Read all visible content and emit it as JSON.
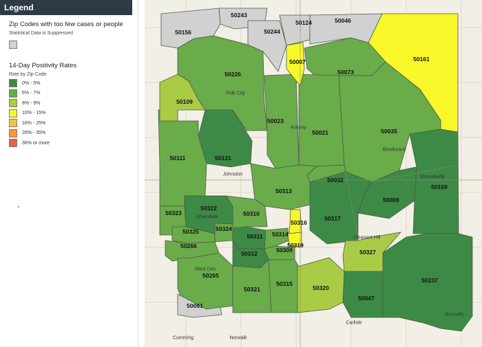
{
  "legend": {
    "header": "Legend",
    "suppressed_title": "Zip Codes with too few cases or people",
    "suppressed_label": "Statistical Data is Suppressed",
    "suppressed_color": "#d1d1d1",
    "rates_title": "14-Day Positivity Rates",
    "rates_sub": "Rate by Zip Code",
    "items": [
      {
        "label": "0% - 5%",
        "color": "#3d8a46"
      },
      {
        "label": "6% - 7%",
        "color": "#6aab4a"
      },
      {
        "label": "8% - 9%",
        "color": "#aacb45"
      },
      {
        "label": "10% - 15%",
        "color": "#f7f72a"
      },
      {
        "label": "16% - 25%",
        "color": "#f8c24a"
      },
      {
        "label": "26% - 35%",
        "color": "#f59a3c"
      },
      {
        "label": "36% or more",
        "color": "#ee5d4b"
      }
    ]
  },
  "map": {
    "zips": [
      {
        "code": "50243",
        "rate_class": "suppressed"
      },
      {
        "code": "50156",
        "rate_class": "suppressed"
      },
      {
        "code": "50244",
        "rate_class": "suppressed"
      },
      {
        "code": "50124",
        "rate_class": "suppressed"
      },
      {
        "code": "50046",
        "rate_class": "suppressed"
      },
      {
        "code": "50161",
        "rate_class": "10% - 15%"
      },
      {
        "code": "50007",
        "rate_class": "10% - 15%"
      },
      {
        "code": "50226",
        "rate_class": "6% - 7%"
      },
      {
        "code": "50073",
        "rate_class": "6% - 7%"
      },
      {
        "code": "50109",
        "rate_class": "8% - 9%"
      },
      {
        "code": "50023",
        "rate_class": "6% - 7%"
      },
      {
        "code": "50021",
        "rate_class": "6% - 7%"
      },
      {
        "code": "50035",
        "rate_class": "6% - 7%"
      },
      {
        "code": "50111",
        "rate_class": "6% - 7%"
      },
      {
        "code": "50131",
        "rate_class": "0% - 5%"
      },
      {
        "code": "50032",
        "rate_class": "6% - 7%"
      },
      {
        "code": "50169",
        "rate_class": "0% - 5%"
      },
      {
        "code": "50313",
        "rate_class": "6% - 7%"
      },
      {
        "code": "50009",
        "rate_class": "0% - 5%"
      },
      {
        "code": "50322",
        "rate_class": "0% - 5%"
      },
      {
        "code": "50310",
        "rate_class": "6% - 7%"
      },
      {
        "code": "50323",
        "rate_class": "6% - 7%"
      },
      {
        "code": "50316",
        "rate_class": "10% - 15%"
      },
      {
        "code": "50317",
        "rate_class": "0% - 5%"
      },
      {
        "code": "50325",
        "rate_class": "6% - 7%"
      },
      {
        "code": "50324",
        "rate_class": "6% - 7%"
      },
      {
        "code": "50314",
        "rate_class": "6% - 7%"
      },
      {
        "code": "50311",
        "rate_class": "0% - 5%"
      },
      {
        "code": "50319",
        "rate_class": "10% - 15%"
      },
      {
        "code": "50266",
        "rate_class": "6% - 7%"
      },
      {
        "code": "50309",
        "rate_class": "6% - 7%"
      },
      {
        "code": "50312",
        "rate_class": "0% - 5%"
      },
      {
        "code": "50327",
        "rate_class": "8% - 9%"
      },
      {
        "code": "50265",
        "rate_class": "6% - 7%"
      },
      {
        "code": "50237",
        "rate_class": "0% - 5%"
      },
      {
        "code": "50315",
        "rate_class": "6% - 7%"
      },
      {
        "code": "50320",
        "rate_class": "8% - 9%"
      },
      {
        "code": "50321",
        "rate_class": "6% - 7%"
      },
      {
        "code": "50047",
        "rate_class": "0% - 5%"
      },
      {
        "code": "50061",
        "rate_class": "suppressed"
      }
    ],
    "places": [
      "Polk City",
      "Ankeny",
      "Bondurant",
      "Johnston",
      "Urbandale",
      "Pleasant Hill",
      "West Des",
      "Norwalk",
      "Carlisle",
      "Cumming",
      "Runnells",
      "Mitchellville"
    ]
  }
}
